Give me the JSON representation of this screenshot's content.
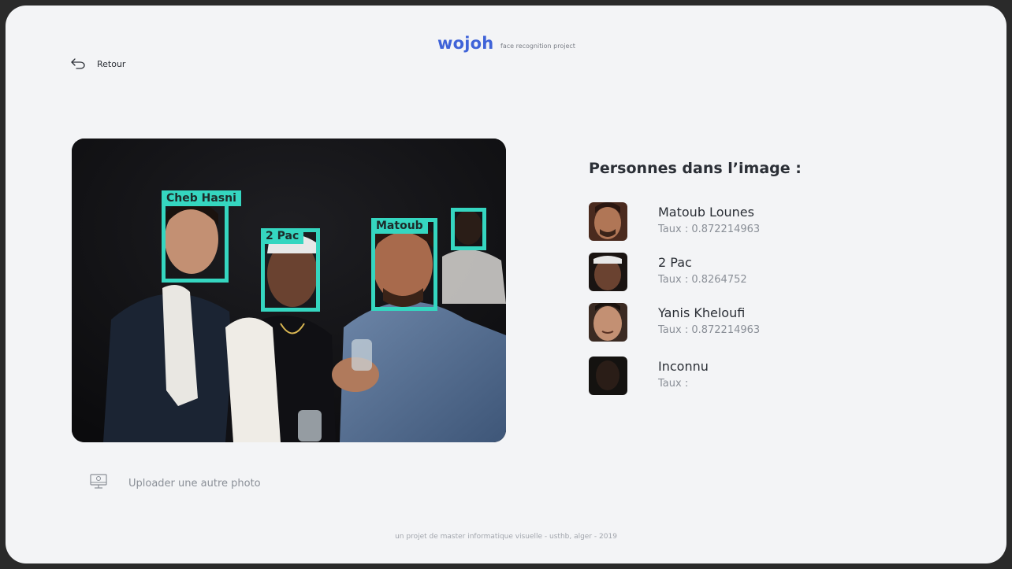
{
  "header": {
    "brand": "wojoh",
    "tagline": "face recognition project",
    "back_label": "Retour"
  },
  "photo": {
    "face_labels": [
      "Cheb Hasni",
      "2 Pac",
      "Matoub"
    ]
  },
  "people": {
    "title": "Personnes dans l’image :",
    "items": [
      {
        "name": "Matoub Lounes",
        "rate": "Taux : 0.872214963"
      },
      {
        "name": "2 Pac",
        "rate": "Taux : 0.8264752"
      },
      {
        "name": "Yanis Kheloufi",
        "rate": "Taux : 0.872214963"
      },
      {
        "name": "Inconnu",
        "rate": "Taux :"
      }
    ]
  },
  "upload": {
    "label": "Uploader une autre photo"
  },
  "footer": {
    "text": "un projet de master informatique visuelle - usthb, alger - 2019"
  },
  "colors": {
    "accent": "#35d6c0",
    "brand": "#3f63d8",
    "background": "#f3f4f6"
  },
  "icons": [
    "back-arrow-icon",
    "upload-monitor-icon"
  ]
}
